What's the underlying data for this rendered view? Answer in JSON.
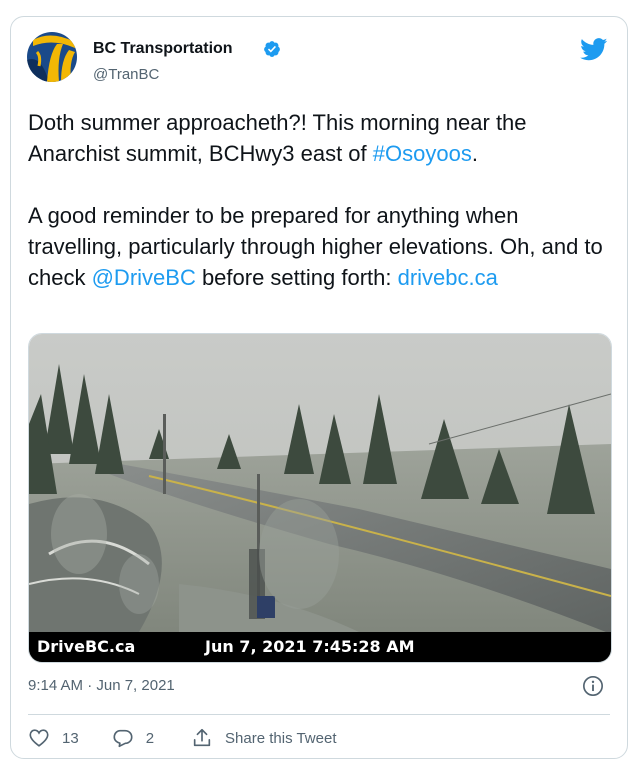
{
  "tweet": {
    "author_name": "BC Transportation",
    "author_handle": "@TranBC",
    "text_p1_a": "Doth summer approacheth?! This morning near the Anarchist summit, BCHwy3 east of ",
    "text_p1_hashtag": "#Osoyoos",
    "text_p1_b": ".",
    "text_p2_a": "A good reminder to be prepared for anything when travelling, particularly through higher elevations. Oh, and to check ",
    "text_p2_mention": "@DriveBC",
    "text_p2_b": " before setting forth: ",
    "text_p2_link": "drivebc.ca",
    "timestamp": "9:14 AM · Jun 7, 2021"
  },
  "media": {
    "caption_left": "DriveBC.ca",
    "caption_right": "Jun 7, 2021 7:45:28 AM"
  },
  "actions": {
    "like_count": "13",
    "reply_count": "2",
    "share_label": "Share this Tweet"
  },
  "colors": {
    "accent": "#1d9bf0",
    "text": "#0f1419",
    "muted": "#536471",
    "border": "#cfd9de"
  },
  "icons": [
    "avatar-logo",
    "verified-badge-icon",
    "twitter-bird-icon",
    "info-icon",
    "heart-icon",
    "reply-icon",
    "share-icon"
  ]
}
